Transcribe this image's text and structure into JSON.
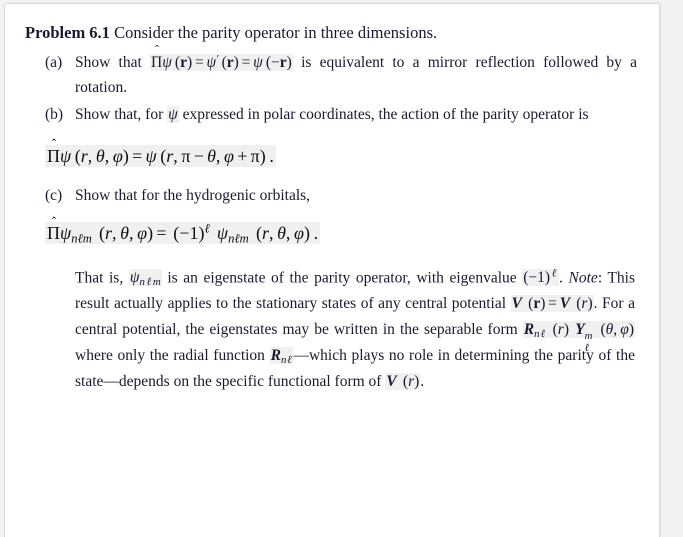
{
  "document": {
    "type": "textbook-problem",
    "background_color": "#f2f2f2",
    "card_color": "#ffffff",
    "border_color": "#d8d8d6",
    "text_color": "#1a1a2e",
    "math_highlight_color": "#f0f0f0"
  },
  "problem": {
    "label": "Problem 6.1",
    "statement": "Consider the parity operator in three dimensions.",
    "parts": [
      {
        "label": "(a)",
        "text_before": "Show that",
        "inline_math": "Π̂ψ (r) = ψ′ (r) = ψ (−r)",
        "text_after": "is equivalent to a mirror reflection followed by a rotation."
      },
      {
        "label": "(b)",
        "text_before": "Show that, for",
        "inline_math": "ψ",
        "text_after": "expressed in polar coordinates, the action of the parity operator is",
        "display_math": "Π̂ψ (r, θ, φ) = ψ (r, π − θ, φ + π)."
      },
      {
        "label": "(c)",
        "text_before": "Show that for the hydrogenic orbitals,",
        "display_math": "Π̂ψnℓm (r, θ, φ) = (−1)^ℓ ψnℓm (r, θ, φ)."
      }
    ],
    "closing_paragraph": {
      "lead": "That is,",
      "psi_symbol": "ψnℓm",
      "continues": "is an eigenstate of the parity operator, with eigenvalue",
      "eigenvalue": "(−1)^ℓ.",
      "note_label": "Note",
      "note_colon": ":",
      "note_text_1": "This result actually applies to the stationary states of any central potential",
      "potential_math": "V (r) = V (r)",
      "note_text_2": ". For a central potential, the eigenstates may be written in the separable form",
      "separable_math": "Rnℓ (r) Yℓ^m (θ, φ)",
      "note_text_3": "where only the radial function",
      "radial_math": "Rnℓ",
      "note_text_4": "—which plays no role in determining the parity of the state—depends on the specific functional form of",
      "final_math": "V (r)",
      "period": "."
    }
  },
  "symbols": {
    "pi_operator": "Π",
    "hat": "ˆ",
    "psi": "ψ",
    "psi_prime": "ψ′",
    "theta": "θ",
    "phi": "φ",
    "pi": "π",
    "ell": "ℓ",
    "minus": "−",
    "equals": "=",
    "plus": "+",
    "emdash": "—"
  }
}
